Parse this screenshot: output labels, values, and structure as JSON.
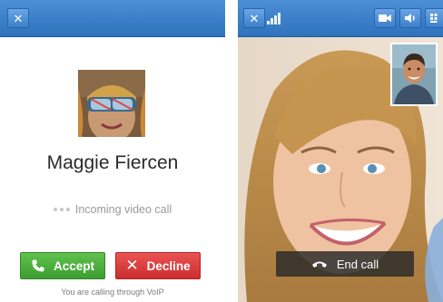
{
  "incoming_screen": {
    "close_icon": "close-icon",
    "caller_name": "Maggie Fiercen",
    "status_text": "Incoming video call",
    "accept_label": "Accept",
    "decline_label": "Decline",
    "footer_text": "You are calling through VoIP"
  },
  "call_screen": {
    "close_icon": "close-icon",
    "signal_icon": "signal-strength-icon",
    "toolbar_icons": [
      "video-camera-icon",
      "speaker-icon",
      "keypad-icon"
    ],
    "end_call_label": "End call"
  },
  "colors": {
    "header_blue": "#3a7ec8",
    "accept_green": "#4cae3c",
    "decline_red": "#de3f3f",
    "end_call_bg": "#2c2c2c"
  }
}
